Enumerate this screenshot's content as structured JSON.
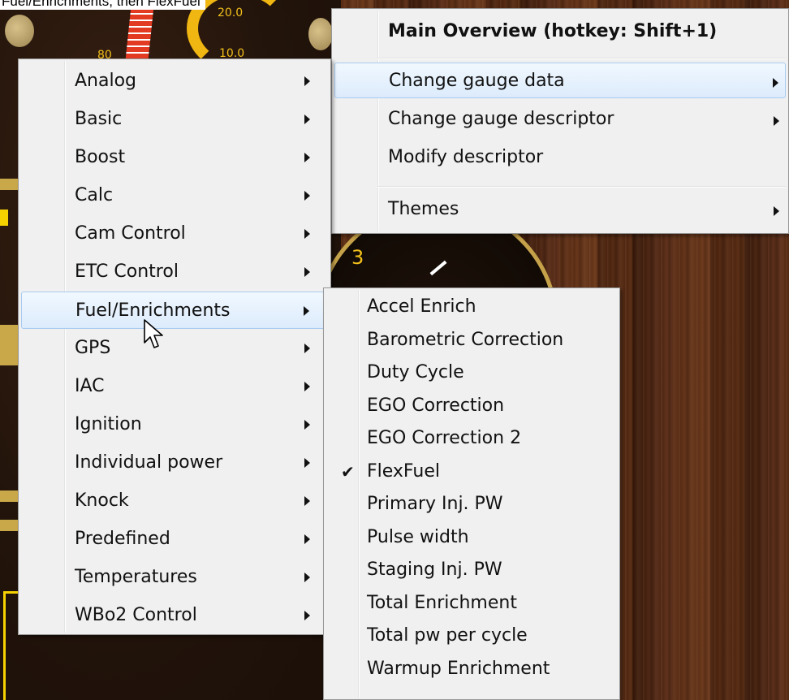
{
  "caption": "Fuel/Enrichments, then FlexFuel",
  "background": {
    "gauge_label": "3",
    "numbers": [
      "20.0",
      "10.0",
      "80"
    ]
  },
  "main_menu": {
    "items": [
      {
        "label": "Main Overview (hotkey: Shift+1)",
        "bold": true,
        "has_submenu": false
      },
      {
        "label": "Change gauge data",
        "has_submenu": true,
        "highlighted": true
      },
      {
        "label": "Change gauge descriptor",
        "has_submenu": true
      },
      {
        "label": "Modify descriptor",
        "has_submenu": false
      },
      {
        "label": "Themes",
        "has_submenu": true
      }
    ]
  },
  "category_menu": {
    "items": [
      {
        "label": "Analog"
      },
      {
        "label": "Basic"
      },
      {
        "label": "Boost"
      },
      {
        "label": "Calc"
      },
      {
        "label": "Cam Control"
      },
      {
        "label": "ETC Control"
      },
      {
        "label": "Fuel/Enrichments",
        "highlighted": true
      },
      {
        "label": "GPS"
      },
      {
        "label": "IAC"
      },
      {
        "label": "Ignition"
      },
      {
        "label": "Individual power"
      },
      {
        "label": "Knock"
      },
      {
        "label": "Predefined"
      },
      {
        "label": "Temperatures"
      },
      {
        "label": "WBo2 Control"
      }
    ]
  },
  "fuel_menu": {
    "items": [
      {
        "label": "Accel Enrich"
      },
      {
        "label": "Barometric Correction"
      },
      {
        "label": "Duty Cycle"
      },
      {
        "label": "EGO Correction"
      },
      {
        "label": "EGO Correction 2"
      },
      {
        "label": "FlexFuel",
        "checked": true
      },
      {
        "label": "Primary Inj. PW"
      },
      {
        "label": "Pulse width"
      },
      {
        "label": "Staging Inj. PW"
      },
      {
        "label": "Total Enrichment"
      },
      {
        "label": "Total pw per cycle"
      },
      {
        "label": "Warmup Enrichment"
      }
    ]
  },
  "colors": {
    "menu_bg": "#f0f0f0",
    "highlight": "#dcebfc",
    "gauge_accent": "#f2c01a"
  }
}
